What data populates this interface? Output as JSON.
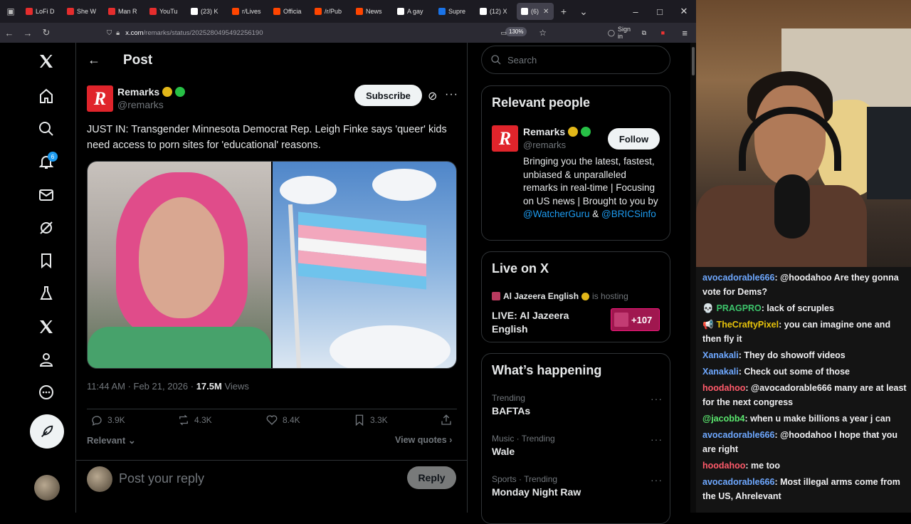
{
  "browser": {
    "tabs": [
      {
        "label": "LoFi D",
        "color": "#e52d2d"
      },
      {
        "label": "She W",
        "color": "#e52d2d"
      },
      {
        "label": "Man R",
        "color": "#e52d2d"
      },
      {
        "label": "YouTu",
        "color": "#e52d2d"
      },
      {
        "label": "(23) K",
        "color": "#ffffff"
      },
      {
        "label": "r/Lives",
        "color": "#ff4500"
      },
      {
        "label": "Officia",
        "color": "#ff4500"
      },
      {
        "label": "/r/Pub",
        "color": "#ff4500"
      },
      {
        "label": "News",
        "color": "#ff4500"
      },
      {
        "label": "A gay",
        "color": "#ffffff"
      },
      {
        "label": "Supre",
        "color": "#1a73e8"
      },
      {
        "label": "(12) X",
        "color": "#ffffff"
      },
      {
        "label": "(6)",
        "color": "#ffffff"
      }
    ],
    "url_host": "x.com",
    "url_path": "/remarks/status/2025280495492256190",
    "zoom": "130%",
    "sign_in": "Sign in"
  },
  "leftnav": {
    "notif_count": "6"
  },
  "post": {
    "header_title": "Post",
    "author_name": "Remarks",
    "author_handle": "@remarks",
    "subscribe_label": "Subscribe",
    "text": "JUST IN: Transgender Minnesota Democrat Rep. Leigh Finke says 'queer' kids need access to porn sites for 'educational' reasons.",
    "time": "11:44 AM · Feb 21, 2026 · ",
    "views_count": "17.5M",
    "views_label": " Views",
    "replies": "3.9K",
    "reposts": "4.3K",
    "likes": "8.4K",
    "bookmarks": "3.3K",
    "sort_label": "Relevant",
    "view_quotes": "View quotes",
    "reply_placeholder": "Post your reply",
    "reply_button": "Reply"
  },
  "sidebar": {
    "search_placeholder": "Search",
    "relevant_people_title": "Relevant people",
    "rp_name": "Remarks",
    "rp_handle": "@remarks",
    "follow_label": "Follow",
    "rp_bio_text": "Bringing you the latest, fastest, unbiased & unparalleled remarks in real-time | Focusing on US news | Brought to you by ",
    "rp_bio_link1": "@WatcherGuru",
    "rp_bio_amp": " & ",
    "rp_bio_link2": "@BRICSinfo",
    "live_title": "Live on X",
    "live_host_name": "Al Jazeera English",
    "live_host_suffix": "is hosting",
    "live_stream_title": "LIVE: Al Jazeera English",
    "live_count": "+107",
    "happening_title": "What’s happening",
    "trends": [
      {
        "category": "Trending",
        "name": "BAFTAs"
      },
      {
        "category": "Music · Trending",
        "name": "Wale"
      },
      {
        "category": "Sports · Trending",
        "name": "Monday Night Raw"
      }
    ]
  },
  "chat": {
    "messages": [
      {
        "user": "avocadorable666",
        "color": "#6ea8ff",
        "badge": "",
        "text": ": @hoodahoo Are they gonna vote for Dems?"
      },
      {
        "user": "PRAGPRO",
        "color": "#3cc46b",
        "badge": "💀",
        "text": ": lack of scruples"
      },
      {
        "user": "TheCraftyPixel",
        "color": "#e8c40b",
        "badge": "📢",
        "text": ": you can imagine one and then fly it"
      },
      {
        "user": "Xanakali",
        "color": "#6ea8ff",
        "badge": "",
        "text": ": They do showoff videos"
      },
      {
        "user": "Xanakali",
        "color": "#6ea8ff",
        "badge": "",
        "text": ": Check out some of those"
      },
      {
        "user": "hoodahoo",
        "color": "#ff5a6a",
        "badge": "",
        "text": ": @avocadorable666 many are at least for the next congress"
      },
      {
        "user": "@jacobb4",
        "color": "#5be86f",
        "badge": "",
        "text": ": when u make billions a year j can"
      },
      {
        "user": "avocadorable666",
        "color": "#6ea8ff",
        "badge": "",
        "text": ": @hoodahoo I hope that you are right"
      },
      {
        "user": "hoodahoo",
        "color": "#ff5a6a",
        "badge": "",
        "text": ": me too"
      },
      {
        "user": "avocadorable666",
        "color": "#6ea8ff",
        "badge": "",
        "text": ": Most illegal arms come from the US, Ahrelevant"
      }
    ]
  }
}
